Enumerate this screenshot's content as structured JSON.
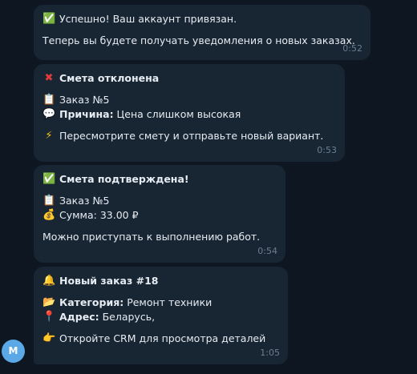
{
  "messages": [
    {
      "icon": "check-icon",
      "title": "Успешно! Ваш аккаунт  привязан.",
      "body": "Теперь вы будете получать уведомления о новых заказах.",
      "time": "0:52"
    },
    {
      "icon": "cross-icon",
      "title": "Смета отклонена",
      "order": "Заказ №5",
      "reason_label": "Причина:",
      "reason_value": " Цена слишком высокая",
      "body": "Пересмотрите смету и отправьте новый вариант.",
      "time": "0:53"
    },
    {
      "icon": "check-icon",
      "title": "Смета подтверждена!",
      "order": "Заказ №5",
      "sum": "Сумма: 33.00 ₽",
      "body": "Можно приступать к выполнению работ.",
      "time": "0:54"
    },
    {
      "icon": "bell-icon",
      "title": "Новый заказ #18",
      "category_label": "Категория:",
      "category_value": " Ремонт техники",
      "address_label": "Адрес:",
      "address_value": " Беларусь,",
      "body": "Откройте CRM для просмотра деталей",
      "time": "1:05"
    }
  ],
  "avatar": {
    "initial": "M",
    "color": "#5aa9e6"
  },
  "colors": {
    "background": "#0e1621",
    "bubble": "#182533",
    "text": "#e6ecf2",
    "time": "#6d7f8f"
  }
}
